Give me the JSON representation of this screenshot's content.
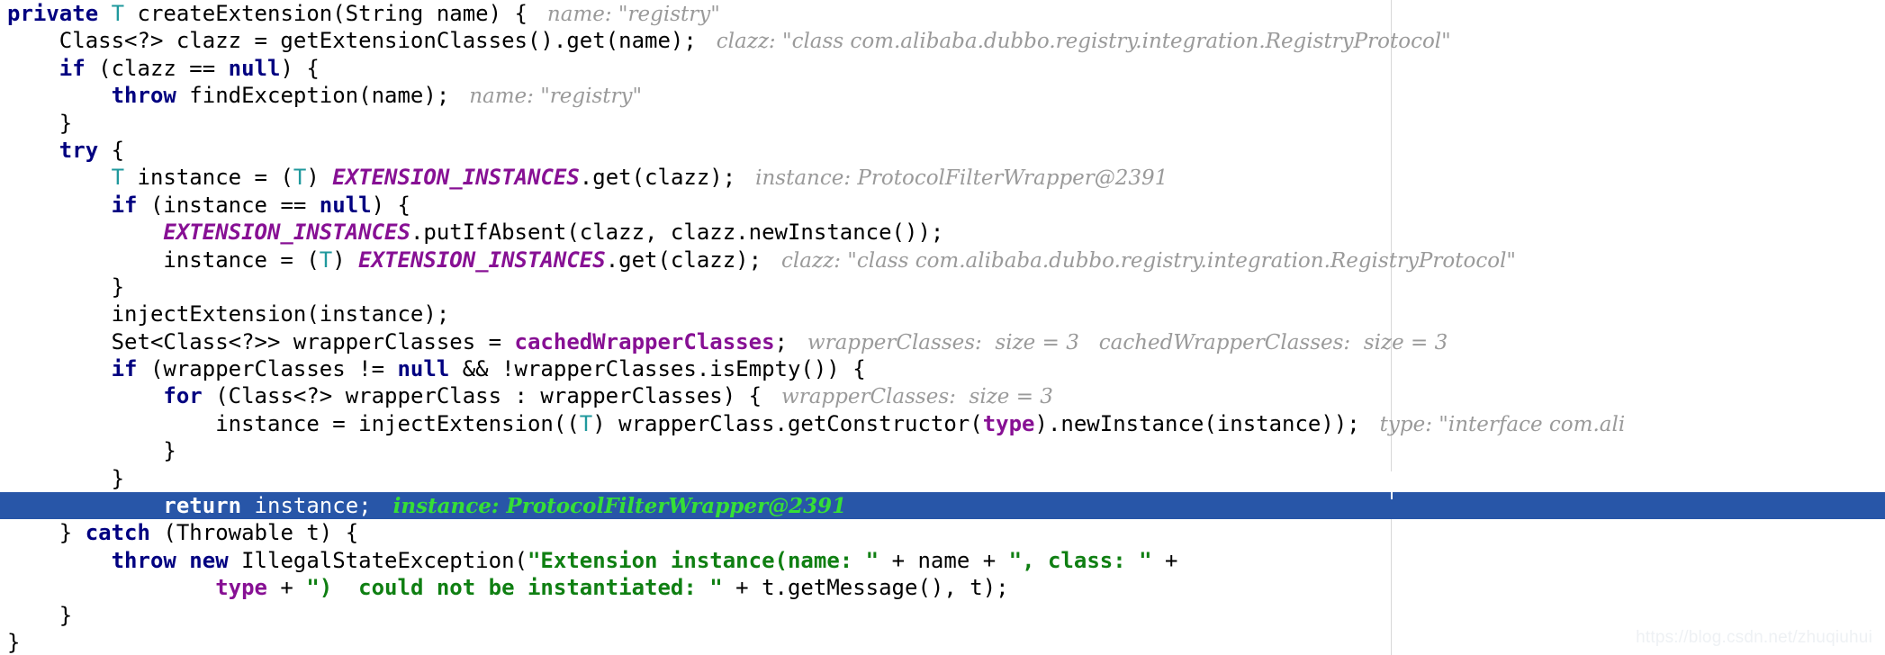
{
  "editor": {
    "language": "java",
    "theme": "light",
    "background_color": "#ffffff",
    "margin_guide_color": "#d8d8d8",
    "highlight_line_background": "#2856A8",
    "highlight_line_text_color": "#ffffff",
    "highlight_hint_color": "#36DF36",
    "keyword_color": "#000080",
    "string_color": "#0F7F12",
    "field_color": "#871094",
    "type_param_color": "#20999D",
    "inline_hint_color": "#9a9a9a"
  },
  "watermark": {
    "text": "https://blog.csdn.net/zhuqiuhui"
  },
  "code": {
    "lines": [
      {
        "index": 1,
        "highlighted": false,
        "tokens": [
          {
            "t": "private ",
            "c": "kw"
          },
          {
            "t": "T",
            "c": "typ"
          },
          {
            "t": " createExtension(String name) {",
            "c": ""
          },
          {
            "t": "   name: \"registry\"",
            "c": "hint"
          }
        ]
      },
      {
        "index": 2,
        "highlighted": false,
        "tokens": [
          {
            "t": "    Class<?> clazz = getExtensionClasses().get(name);",
            "c": ""
          },
          {
            "t": "   clazz: \"class com.alibaba.dubbo.registry.integration.RegistryProtocol\"",
            "c": "hint"
          }
        ]
      },
      {
        "index": 3,
        "highlighted": false,
        "tokens": [
          {
            "t": "    ",
            "c": ""
          },
          {
            "t": "if",
            "c": "kw"
          },
          {
            "t": " (clazz == ",
            "c": ""
          },
          {
            "t": "null",
            "c": "kw"
          },
          {
            "t": ") {",
            "c": ""
          }
        ]
      },
      {
        "index": 4,
        "highlighted": false,
        "tokens": [
          {
            "t": "        ",
            "c": ""
          },
          {
            "t": "throw",
            "c": "kw"
          },
          {
            "t": " findException(name);",
            "c": ""
          },
          {
            "t": "   name: \"registry\"",
            "c": "hint"
          }
        ]
      },
      {
        "index": 5,
        "highlighted": false,
        "tokens": [
          {
            "t": "    }",
            "c": ""
          }
        ]
      },
      {
        "index": 6,
        "highlighted": false,
        "tokens": [
          {
            "t": "    ",
            "c": ""
          },
          {
            "t": "try",
            "c": "kw"
          },
          {
            "t": " {",
            "c": ""
          }
        ]
      },
      {
        "index": 7,
        "highlighted": false,
        "tokens": [
          {
            "t": "        ",
            "c": ""
          },
          {
            "t": "T",
            "c": "typ"
          },
          {
            "t": " instance = (",
            "c": ""
          },
          {
            "t": "T",
            "c": "typ"
          },
          {
            "t": ") ",
            "c": ""
          },
          {
            "t": "EXTENSION_INSTANCES",
            "c": "sfld"
          },
          {
            "t": ".get(clazz);",
            "c": ""
          },
          {
            "t": "   instance: ProtocolFilterWrapper@2391",
            "c": "hint"
          }
        ]
      },
      {
        "index": 8,
        "highlighted": false,
        "tokens": [
          {
            "t": "        ",
            "c": ""
          },
          {
            "t": "if",
            "c": "kw"
          },
          {
            "t": " (instance == ",
            "c": ""
          },
          {
            "t": "null",
            "c": "kw"
          },
          {
            "t": ") {",
            "c": ""
          }
        ]
      },
      {
        "index": 9,
        "highlighted": false,
        "tokens": [
          {
            "t": "            ",
            "c": ""
          },
          {
            "t": "EXTENSION_INSTANCES",
            "c": "sfld"
          },
          {
            "t": ".putIfAbsent(clazz, clazz.newInstance());",
            "c": ""
          }
        ]
      },
      {
        "index": 10,
        "highlighted": false,
        "tokens": [
          {
            "t": "            instance = (",
            "c": ""
          },
          {
            "t": "T",
            "c": "typ"
          },
          {
            "t": ") ",
            "c": ""
          },
          {
            "t": "EXTENSION_INSTANCES",
            "c": "sfld"
          },
          {
            "t": ".get(clazz);",
            "c": ""
          },
          {
            "t": "   clazz: \"class com.alibaba.dubbo.registry.integration.RegistryProtocol\"",
            "c": "hint"
          }
        ]
      },
      {
        "index": 11,
        "highlighted": false,
        "tokens": [
          {
            "t": "        }",
            "c": ""
          }
        ]
      },
      {
        "index": 12,
        "highlighted": false,
        "tokens": [
          {
            "t": "        injectExtension(instance);",
            "c": ""
          }
        ]
      },
      {
        "index": 13,
        "highlighted": false,
        "tokens": [
          {
            "t": "        Set<Class<?>> wrapperClasses = ",
            "c": ""
          },
          {
            "t": "cachedWrapperClasses",
            "c": "fld"
          },
          {
            "t": ";",
            "c": ""
          },
          {
            "t": "   wrapperClasses:  size = 3   cachedWrapperClasses:  size = 3",
            "c": "hint"
          }
        ]
      },
      {
        "index": 14,
        "highlighted": false,
        "tokens": [
          {
            "t": "        ",
            "c": ""
          },
          {
            "t": "if",
            "c": "kw"
          },
          {
            "t": " (wrapperClasses != ",
            "c": ""
          },
          {
            "t": "null",
            "c": "kw"
          },
          {
            "t": " && !wrapperClasses.isEmpty()) {",
            "c": ""
          }
        ]
      },
      {
        "index": 15,
        "highlighted": false,
        "tokens": [
          {
            "t": "            ",
            "c": ""
          },
          {
            "t": "for",
            "c": "kw"
          },
          {
            "t": " (Class<?> wrapperClass : wrapperClasses) {",
            "c": ""
          },
          {
            "t": "   wrapperClasses:  size = 3",
            "c": "hint"
          }
        ]
      },
      {
        "index": 16,
        "highlighted": false,
        "tokens": [
          {
            "t": "                instance = injectExtension((",
            "c": ""
          },
          {
            "t": "T",
            "c": "typ"
          },
          {
            "t": ") wrapperClass.getConstructor(",
            "c": ""
          },
          {
            "t": "type",
            "c": "fld"
          },
          {
            "t": ").newInstance(instance));",
            "c": ""
          },
          {
            "t": "   type: \"interface com.ali",
            "c": "hint"
          }
        ]
      },
      {
        "index": 17,
        "highlighted": false,
        "tokens": [
          {
            "t": "            }",
            "c": ""
          }
        ]
      },
      {
        "index": 18,
        "highlighted": false,
        "tokens": [
          {
            "t": "        }",
            "c": ""
          }
        ]
      },
      {
        "index": 19,
        "highlighted": true,
        "tokens": [
          {
            "t": "            ",
            "c": ""
          },
          {
            "t": "return",
            "c": "kw"
          },
          {
            "t": " instance;",
            "c": ""
          },
          {
            "t": "   instance: ProtocolFilterWrapper@2391",
            "c": "hint"
          }
        ]
      },
      {
        "index": 20,
        "highlighted": false,
        "tokens": [
          {
            "t": "    } ",
            "c": ""
          },
          {
            "t": "catch",
            "c": "kw"
          },
          {
            "t": " (Throwable t) {",
            "c": ""
          }
        ]
      },
      {
        "index": 21,
        "highlighted": false,
        "tokens": [
          {
            "t": "        ",
            "c": ""
          },
          {
            "t": "throw new",
            "c": "kw"
          },
          {
            "t": " IllegalStateException(",
            "c": ""
          },
          {
            "t": "\"Extension instance(name: \"",
            "c": "str"
          },
          {
            "t": " + name + ",
            "c": ""
          },
          {
            "t": "\", class: \"",
            "c": "str"
          },
          {
            "t": " +",
            "c": ""
          }
        ]
      },
      {
        "index": 22,
        "highlighted": false,
        "tokens": [
          {
            "t": "                ",
            "c": ""
          },
          {
            "t": "type",
            "c": "fld"
          },
          {
            "t": " + ",
            "c": ""
          },
          {
            "t": "\")  could not be instantiated: \"",
            "c": "str"
          },
          {
            "t": " + t.getMessage(), t);",
            "c": ""
          }
        ]
      },
      {
        "index": 23,
        "highlighted": false,
        "tokens": [
          {
            "t": "    }",
            "c": ""
          }
        ]
      },
      {
        "index": 24,
        "highlighted": false,
        "tokens": [
          {
            "t": "}",
            "c": ""
          }
        ]
      }
    ]
  }
}
